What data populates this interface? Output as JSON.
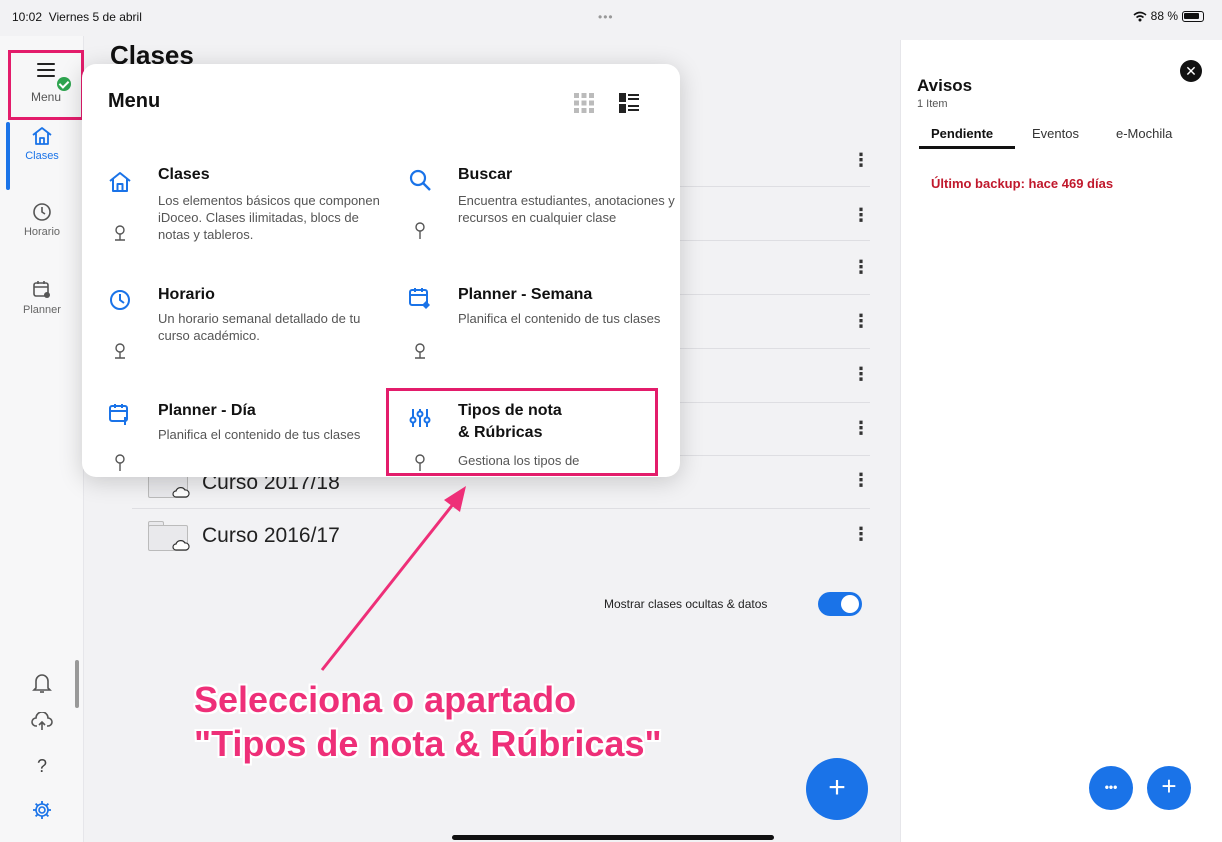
{
  "status_bar": {
    "time": "10:02",
    "date": "Viernes 5 de abril",
    "dots": "•••",
    "wifi_battery": "88 %"
  },
  "rail": {
    "menu_label": "Menu",
    "items": [
      {
        "label": "Clases",
        "icon": "home-icon"
      },
      {
        "label": "Horario",
        "icon": "clock-icon"
      },
      {
        "label": "Planner",
        "icon": "planner-icon"
      }
    ],
    "bottom_icons": [
      "bell-icon",
      "cloud-sync-icon",
      "help-icon",
      "gear-icon"
    ],
    "help_glyph": "?"
  },
  "main": {
    "title": "Clases",
    "folders": [
      {
        "name": "Curso 2017/18"
      },
      {
        "name": "Curso 2016/17"
      }
    ],
    "kebab": "⋮",
    "toggle_label": "Mostrar clases ocultas & datos",
    "toggle_on": true,
    "fab": "+"
  },
  "menu": {
    "title": "Menu",
    "items": [
      {
        "title": "Clases",
        "desc": "Los elementos básicos que componen iDoceo. Clases ilimitadas, blocs de notas y tableros.",
        "icon": "home-icon"
      },
      {
        "title": "Buscar",
        "desc": "Encuentra estudiantes, anotaciones y recursos en cualquier clase",
        "icon": "search-icon"
      },
      {
        "title": "Horario",
        "desc": "Un horario semanal detallado de tu curso académico.",
        "icon": "clock-icon"
      },
      {
        "title": "Planner - Semana",
        "desc": "Planifica el contenido de tus clases",
        "icon": "planner-week-icon"
      },
      {
        "title": "Planner - Día",
        "desc": "Planifica el contenido de tus clases",
        "icon": "planner-day-icon"
      },
      {
        "title": "Tipos de nota & Rúbricas",
        "title_line1": "Tipos de nota",
        "title_line2": "& Rúbricas",
        "desc": "Gestiona los tipos de",
        "icon": "sliders-icon"
      }
    ]
  },
  "panel": {
    "title": "Avisos",
    "subtitle": "1 Item",
    "close": "✕",
    "tabs": [
      {
        "label": "Pendiente",
        "active": true
      },
      {
        "label": "Eventos",
        "active": false
      },
      {
        "label": "e-Mochila",
        "active": false
      }
    ],
    "message": "Último backup: hace 469 días",
    "fab_more": "•••",
    "fab_add": "+"
  },
  "annotation": {
    "line1": "Selecciona o apartado",
    "line2": "\"Tipos de nota & Rúbricas\""
  },
  "colors": {
    "accent": "#1a73e8",
    "highlight": "#e31c6b",
    "annotation": "#ee2f78",
    "warning": "#c0182c"
  }
}
